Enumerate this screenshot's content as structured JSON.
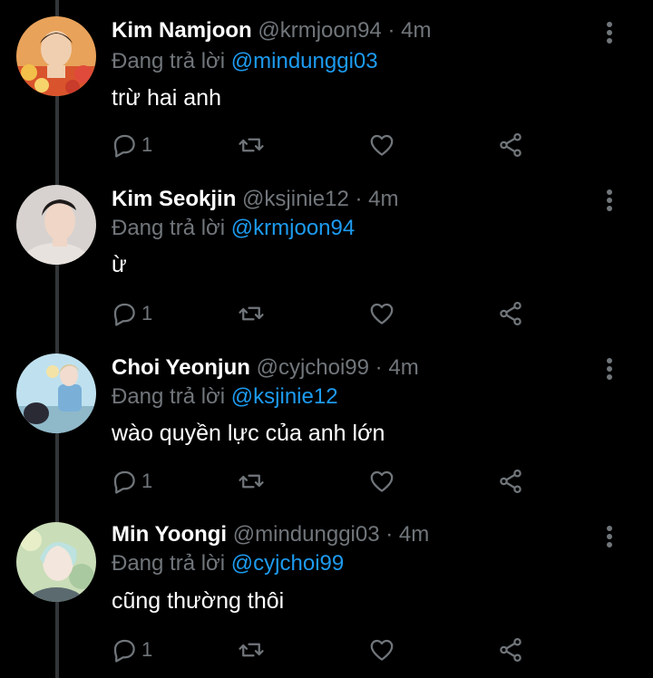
{
  "colors": {
    "background": "#000000",
    "primary_text": "#ffffff",
    "secondary_text": "#71767b",
    "mention": "#1d9bf0",
    "thread_line": "#333639"
  },
  "tweets": [
    {
      "name": "Kim Namjoon",
      "handle": "@krmjoon94",
      "separator": "·",
      "time": "4m",
      "replying_label": "Đang trả lời",
      "replying_to": "@mindunggi03",
      "text": "trừ hai anh",
      "reply_count": "1",
      "avatar_icon": "avatar-photo"
    },
    {
      "name": "Kim Seokjin",
      "handle": "@ksjinie12",
      "separator": "·",
      "time": "4m",
      "replying_label": "Đang trả lời",
      "replying_to": "@krmjoon94",
      "text": "ừ",
      "reply_count": "1",
      "avatar_icon": "avatar-photo"
    },
    {
      "name": "Choi Yeonjun",
      "handle": "@cyjchoi99",
      "separator": "·",
      "time": "4m",
      "replying_label": "Đang trả lời",
      "replying_to": "@ksjinie12",
      "text": "wào quyền lực của anh lớn",
      "reply_count": "1",
      "avatar_icon": "avatar-photo"
    },
    {
      "name": "Min Yoongi",
      "handle": "@mindunggi03",
      "separator": "·",
      "time": "4m",
      "replying_label": "Đang trả lời",
      "replying_to": "@cyjchoi99",
      "text": "cũng thường thôi",
      "reply_count": "1",
      "avatar_icon": "avatar-photo"
    }
  ]
}
